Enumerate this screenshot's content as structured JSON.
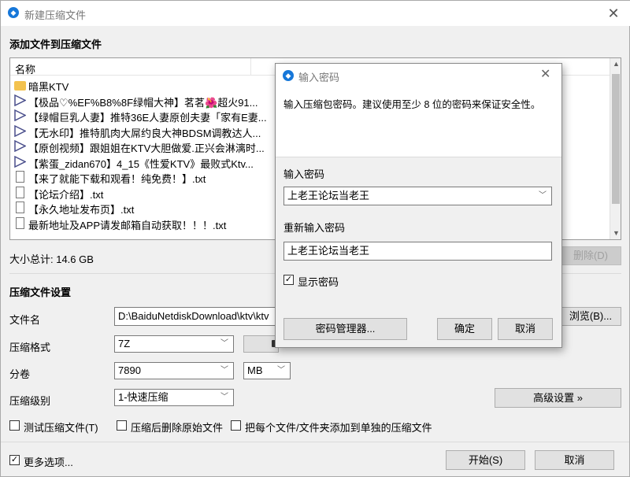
{
  "window": {
    "title": "新建压缩文件",
    "close_icon": "close-icon"
  },
  "section_add": {
    "label": "添加文件到压缩文件"
  },
  "file_list": {
    "column_name": "名称",
    "rows": [
      {
        "type": "folder",
        "name": "暗黑KTV"
      },
      {
        "type": "video",
        "name": "【极品♡%EF%B8%8F绿帽大神】茗茗🌺超火91..."
      },
      {
        "type": "video",
        "name": "【绿帽巨乳人妻】推特36E人妻原创夫妻「家有E妻..."
      },
      {
        "type": "video",
        "name": "【无水印】推特肌肉大屌约良大神BDSM调教达人..."
      },
      {
        "type": "video",
        "name": "【原创视频】跟姐姐在KTV大胆做爱.正兴会淋漓时..."
      },
      {
        "type": "video",
        "name": "【紫蛋_zidan670】4_15《性爱KTV》最败式Ktv..."
      },
      {
        "type": "text",
        "name": "【来了就能下载和观看！纯免费！】.txt"
      },
      {
        "type": "text",
        "name": "【论坛介绍】.txt"
      },
      {
        "type": "text",
        "name": "【永久地址发布页】.txt"
      },
      {
        "type": "text",
        "name": "最新地址及APP请发邮箱自动获取！！！.txt"
      }
    ]
  },
  "total_size": "大小总计: 14.6 GB",
  "delete_button": "删除(D)",
  "section_settings": {
    "label": "压缩文件设置"
  },
  "filename": {
    "label": "文件名",
    "value": "D:\\BaiduNetdiskDownload\\ktv\\ktv"
  },
  "browse_button": "浏览(B)...",
  "format": {
    "label": "压缩格式",
    "value": "7Z"
  },
  "volume": {
    "label": "分卷",
    "value": "7890",
    "unit": "MB"
  },
  "level": {
    "label": "压缩级别",
    "value": "1-快速压缩"
  },
  "advanced_button": "高级设置 »",
  "options": {
    "test": "测试压缩文件(T)",
    "delete_after": "压缩后删除原始文件",
    "separate": "把每个文件/文件夹添加到单独的压缩文件"
  },
  "more_options": "更多选项...",
  "start_button": "开始(S)",
  "cancel_button": "取消",
  "password_dialog": {
    "title": "输入密码",
    "hint": "输入压缩包密码。建议使用至少 8 位的密码来保证安全性。",
    "password_label": "输入密码",
    "password_value": "上老王论坛当老王",
    "confirm_label": "重新输入密码",
    "confirm_value": "上老王论坛当老王",
    "show_password": "显示密码",
    "manager_button": "密码管理器...",
    "ok_button": "确定",
    "cancel_button": "取消"
  }
}
